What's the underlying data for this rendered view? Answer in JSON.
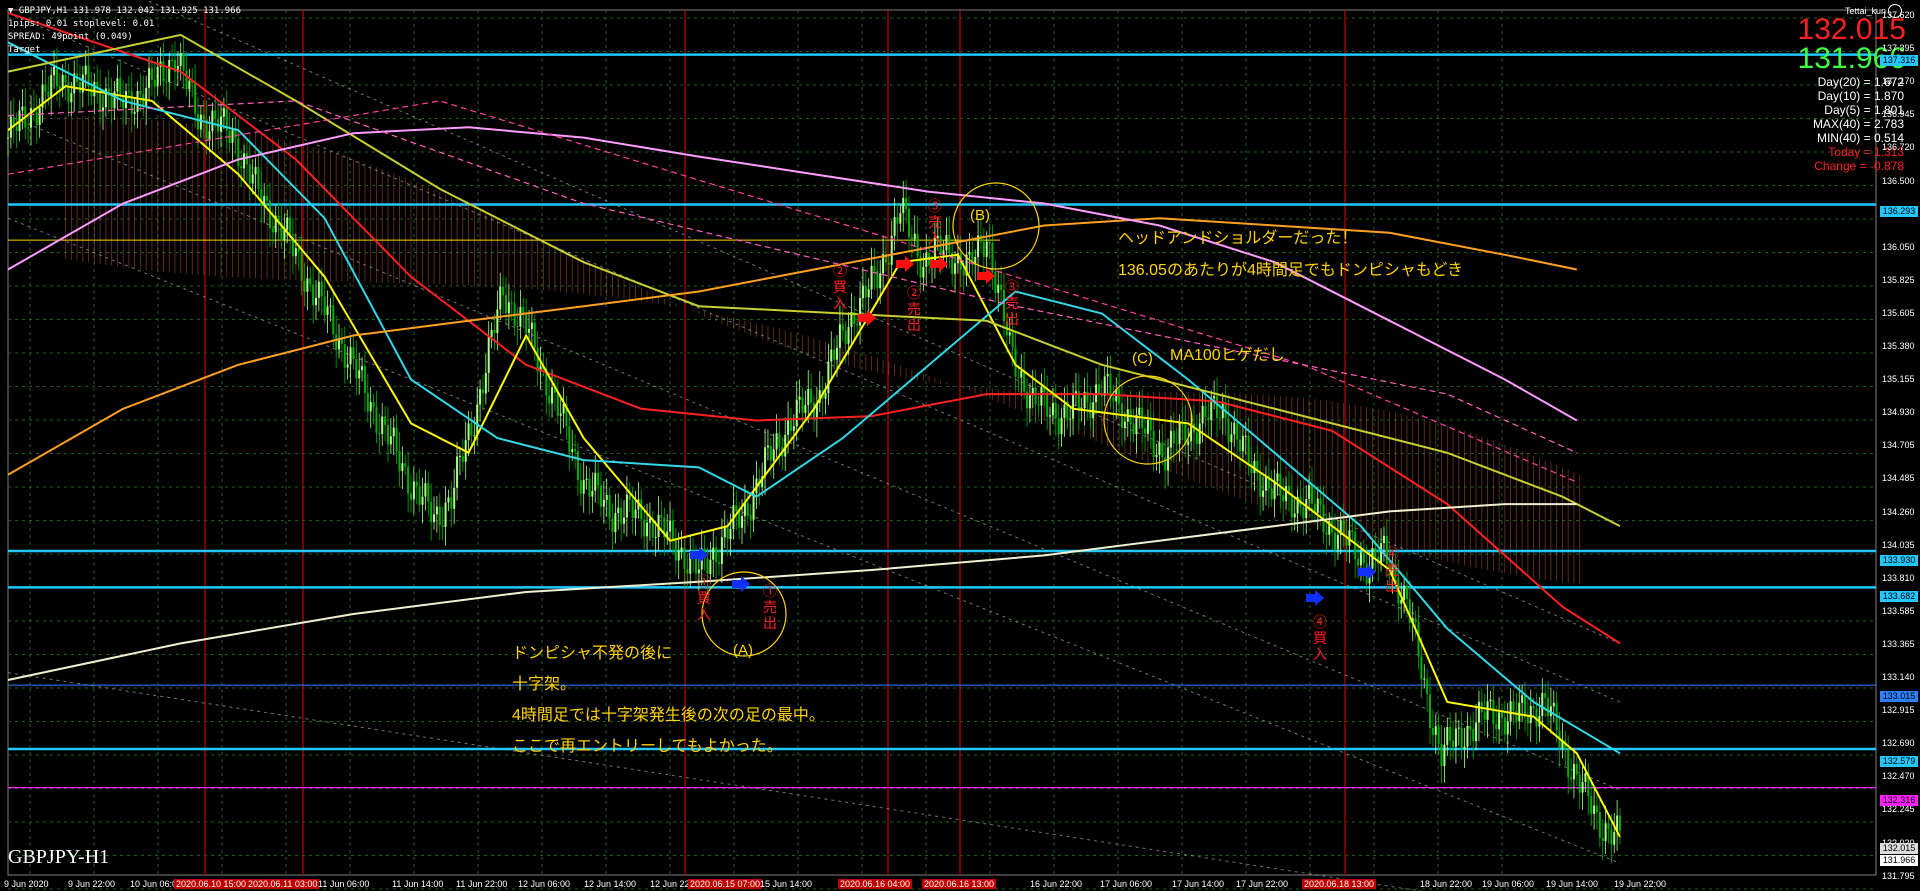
{
  "header": {
    "symbol_line": "▼ GBPJPY,H1  131.978 132.042 131.925 131.966",
    "pips_line": "1pips: 0.01  stoplevel: 0.01",
    "spread_line": "SPREAD: 49point (0.049)",
    "target_line": "Target",
    "brand": "Tettai_kun",
    "brand_icon": "face-icon"
  },
  "quote": {
    "ask": "132.015",
    "bid": "131.966",
    "ask_color": "#ff2020",
    "bid_color": "#40ff40"
  },
  "stats": [
    {
      "text": "Day(20) = 1.672",
      "color": "#ffffff"
    },
    {
      "text": "Day(10) = 1.870",
      "color": "#ffffff"
    },
    {
      "text": "Day(5) = 1.801",
      "color": "#ffffff"
    },
    {
      "text": "MAX(40) = 2.783",
      "color": "#ffffff"
    },
    {
      "text": "MIN(40) = 0.514",
      "color": "#ffffff"
    },
    {
      "text": "Today = 1.313",
      "color": "#ff2020"
    },
    {
      "text": "Change = -0.878",
      "color": "#ff2020"
    }
  ],
  "chart_title": "GBPJPY-H1",
  "price_axis": [
    "137.620",
    "137.395",
    "137.170",
    "136.945",
    "136.720",
    "136.500",
    "136.275",
    "136.050",
    "135.825",
    "135.605",
    "135.380",
    "135.155",
    "134.930",
    "134.705",
    "134.485",
    "134.260",
    "134.035",
    "133.810",
    "133.585",
    "133.365",
    "133.140",
    "132.915",
    "132.690",
    "132.470",
    "132.245",
    "132.020",
    "131.795"
  ],
  "price_boxes": [
    {
      "text": "137.316",
      "bg": "#22c8ff"
    },
    {
      "text": "136.293",
      "bg": "#22c8ff"
    },
    {
      "text": "133.930",
      "bg": "#22c8ff"
    },
    {
      "text": "133.682",
      "bg": "#22c8ff"
    },
    {
      "text": "133.015",
      "bg": "#2a80ff"
    },
    {
      "text": "132.579",
      "bg": "#22c8ff"
    },
    {
      "text": "132.316",
      "bg": "#ff20ff"
    },
    {
      "text": "132.015",
      "bg": "#dddddd"
    },
    {
      "text": "131.966",
      "bg": "#ffffff"
    }
  ],
  "time_axis": [
    {
      "text": "9 Jun 2020",
      "highlight": false
    },
    {
      "text": "9 Jun 22:00",
      "highlight": false
    },
    {
      "text": "10 Jun 06:00",
      "highlight": false
    },
    {
      "text": "2020.06.10 15:00",
      "highlight": true
    },
    {
      "text": "2020.06.11 03:00",
      "highlight": true
    },
    {
      "text": "11 Jun 06:00",
      "highlight": false
    },
    {
      "text": "11 Jun 14:00",
      "highlight": false
    },
    {
      "text": "11 Jun 22:00",
      "highlight": false
    },
    {
      "text": "12 Jun 06:00",
      "highlight": false
    },
    {
      "text": "12 Jun 14:00",
      "highlight": false
    },
    {
      "text": "12 Jun 22:00",
      "highlight": false
    },
    {
      "text": "2020.06.15 07:00",
      "highlight": true
    },
    {
      "text": "15 Jun 14:00",
      "highlight": false
    },
    {
      "text": "2020.06.16 04:00",
      "highlight": true
    },
    {
      "text": "2020.06.16 13:00",
      "highlight": true
    },
    {
      "text": "16 Jun 22:00",
      "highlight": false
    },
    {
      "text": "17 Jun 06:00",
      "highlight": false
    },
    {
      "text": "17 Jun 14:00",
      "highlight": false
    },
    {
      "text": "17 Jun 22:00",
      "highlight": false
    },
    {
      "text": "2020.06.18 13:00",
      "highlight": true
    },
    {
      "text": "18 Jun 22:00",
      "highlight": false
    },
    {
      "text": "19 Jun 06:00",
      "highlight": false
    },
    {
      "text": "19 Jun 14:00",
      "highlight": false
    },
    {
      "text": "19 Jun 22:00",
      "highlight": false
    }
  ],
  "annotations": {
    "head_shoulders": "ヘッドアンドショルダーだった！",
    "level_note": "136.05のあたりが4時間足でもドンピシャもどき",
    "ma100": "MA100ヒゲだし",
    "note_lines": [
      "ドンピシャ不発の後に",
      "十字架。",
      "4時間足では十字架発生後の次の足の最中。",
      "ここで再エントリーしてもよかった。"
    ],
    "circle_a": "(A)",
    "circle_b": "(B)",
    "circle_c": "(C)",
    "trades": {
      "t1_buy": "①買入",
      "t1_sell": "①売出",
      "t2_buy": "②買入",
      "t2_sell": "②売出",
      "t3_buy": "③売入",
      "t3_sell": "③売出",
      "t4_buy": "④買入",
      "t4_sell": "④売出"
    }
  },
  "arrow_icons": {
    "buy": "blue-arrow-right-icon",
    "sell": "red-arrow-right-icon"
  },
  "colors": {
    "bull": "#aaff88",
    "bear": "#00b000",
    "grid": "#1f5f1f",
    "hline": "#22c8ff",
    "vline": "#c00000",
    "ann": "#ffd400",
    "ma_red": "#ff2020",
    "ma_yellow": "#ffff00",
    "ma_cyan": "#30d8e8",
    "ma_olive": "#c8d030",
    "ma_orange": "#ffa020",
    "ma_pink": "#ff9cff",
    "ma_white": "#f0f0d0",
    "cloud": "#b05030"
  },
  "chart_data": {
    "type": "candlestick",
    "symbol": "GBPJPY",
    "timeframe": "H1",
    "ylim": [
      131.795,
      137.62
    ],
    "price_lines": [
      137.316,
      136.293,
      133.93,
      133.682,
      133.015,
      132.579,
      132.316
    ],
    "vertical_markers": [
      "2020.06.10 15:00",
      "2020.06.11 03:00",
      "2020.06.15 07:00",
      "2020.06.16 04:00",
      "2020.06.16 13:00",
      "2020.06.18 13:00"
    ],
    "close_path": [
      [
        0,
        136.75
      ],
      [
        18,
        137.15
      ],
      [
        30,
        137.08
      ],
      [
        40,
        136.99
      ],
      [
        50,
        137.1
      ],
      [
        58,
        137.32
      ],
      [
        66,
        136.9
      ],
      [
        78,
        136.78
      ],
      [
        86,
        136.4
      ],
      [
        96,
        136.1
      ],
      [
        104,
        135.78
      ],
      [
        112,
        135.5
      ],
      [
        122,
        135.1
      ],
      [
        132,
        134.7
      ],
      [
        140,
        134.4
      ],
      [
        148,
        134.15
      ],
      [
        154,
        134.3
      ],
      [
        162,
        134.85
      ],
      [
        172,
        135.7
      ],
      [
        180,
        135.45
      ],
      [
        190,
        134.95
      ],
      [
        200,
        134.4
      ],
      [
        210,
        134.2
      ],
      [
        220,
        134.18
      ],
      [
        232,
        133.98
      ],
      [
        240,
        133.78
      ],
      [
        248,
        134.0
      ],
      [
        256,
        134.2
      ],
      [
        264,
        134.55
      ],
      [
        272,
        134.82
      ],
      [
        282,
        135.0
      ],
      [
        292,
        135.5
      ],
      [
        302,
        135.8
      ],
      [
        310,
        136.25
      ],
      [
        318,
        135.9
      ],
      [
        326,
        136.0
      ],
      [
        334,
        135.85
      ],
      [
        340,
        136.1
      ],
      [
        348,
        135.3
      ],
      [
        356,
        134.95
      ],
      [
        368,
        134.85
      ],
      [
        380,
        135.05
      ],
      [
        392,
        134.8
      ],
      [
        402,
        134.6
      ],
      [
        414,
        134.82
      ],
      [
        422,
        134.9
      ],
      [
        432,
        134.5
      ],
      [
        442,
        134.3
      ],
      [
        452,
        134.25
      ],
      [
        462,
        134.05
      ],
      [
        472,
        133.85
      ],
      [
        478,
        133.9
      ],
      [
        486,
        133.6
      ],
      [
        492,
        133.0
      ],
      [
        498,
        132.55
      ],
      [
        506,
        132.7
      ],
      [
        514,
        132.82
      ],
      [
        524,
        132.8
      ],
      [
        534,
        132.9
      ],
      [
        540,
        132.6
      ],
      [
        546,
        132.35
      ],
      [
        552,
        132.1
      ],
      [
        560,
        131.97
      ]
    ],
    "candle_count": 561,
    "moving_averages": [
      {
        "color_key": "ma_red",
        "pts": [
          [
            0,
            137.6
          ],
          [
            60,
            137.2
          ],
          [
            100,
            136.6
          ],
          [
            140,
            135.8
          ],
          [
            180,
            135.2
          ],
          [
            220,
            134.9
          ],
          [
            260,
            134.82
          ],
          [
            300,
            134.85
          ],
          [
            340,
            135.0
          ],
          [
            380,
            135.0
          ],
          [
            420,
            134.95
          ],
          [
            460,
            134.75
          ],
          [
            500,
            134.25
          ],
          [
            540,
            133.55
          ],
          [
            560,
            133.3
          ]
        ]
      },
      {
        "color_key": "ma_yellow",
        "pts": [
          [
            0,
            136.8
          ],
          [
            20,
            137.1
          ],
          [
            50,
            137.0
          ],
          [
            80,
            136.5
          ],
          [
            110,
            135.8
          ],
          [
            140,
            134.8
          ],
          [
            160,
            134.6
          ],
          [
            180,
            135.4
          ],
          [
            200,
            134.7
          ],
          [
            230,
            134.0
          ],
          [
            250,
            134.1
          ],
          [
            280,
            134.9
          ],
          [
            310,
            135.9
          ],
          [
            330,
            135.95
          ],
          [
            350,
            135.2
          ],
          [
            370,
            134.9
          ],
          [
            410,
            134.8
          ],
          [
            440,
            134.4
          ],
          [
            480,
            133.8
          ],
          [
            500,
            132.9
          ],
          [
            530,
            132.8
          ],
          [
            545,
            132.55
          ],
          [
            560,
            131.98
          ]
        ]
      },
      {
        "color_key": "ma_cyan",
        "pts": [
          [
            0,
            137.4
          ],
          [
            40,
            137.0
          ],
          [
            80,
            136.8
          ],
          [
            110,
            136.2
          ],
          [
            140,
            135.1
          ],
          [
            170,
            134.7
          ],
          [
            200,
            134.55
          ],
          [
            240,
            134.5
          ],
          [
            260,
            134.3
          ],
          [
            290,
            134.7
          ],
          [
            320,
            135.2
          ],
          [
            350,
            135.7
          ],
          [
            380,
            135.55
          ],
          [
            410,
            135.1
          ],
          [
            440,
            134.6
          ],
          [
            470,
            134.1
          ],
          [
            500,
            133.4
          ],
          [
            530,
            132.9
          ],
          [
            560,
            132.55
          ]
        ]
      },
      {
        "color_key": "ma_olive",
        "pts": [
          [
            0,
            137.2
          ],
          [
            60,
            137.45
          ],
          [
            100,
            137.0
          ],
          [
            150,
            136.4
          ],
          [
            200,
            135.9
          ],
          [
            240,
            135.6
          ],
          [
            290,
            135.55
          ],
          [
            340,
            135.5
          ],
          [
            380,
            135.2
          ],
          [
            420,
            135.0
          ],
          [
            460,
            134.8
          ],
          [
            500,
            134.6
          ],
          [
            540,
            134.3
          ],
          [
            560,
            134.1
          ]
        ]
      },
      {
        "color_key": "ma_orange",
        "pts": [
          [
            0,
            134.45
          ],
          [
            40,
            134.9
          ],
          [
            80,
            135.2
          ],
          [
            120,
            135.4
          ],
          [
            160,
            135.5
          ],
          [
            200,
            135.6
          ],
          [
            240,
            135.7
          ],
          [
            280,
            135.85
          ],
          [
            320,
            136.0
          ],
          [
            360,
            136.15
          ],
          [
            400,
            136.2
          ],
          [
            440,
            136.15
          ],
          [
            480,
            136.1
          ],
          [
            520,
            135.95
          ],
          [
            545,
            135.85
          ]
        ]
      },
      {
        "color_key": "ma_pink",
        "pts": [
          [
            0,
            135.85
          ],
          [
            40,
            136.3
          ],
          [
            80,
            136.6
          ],
          [
            120,
            136.78
          ],
          [
            160,
            136.82
          ],
          [
            200,
            136.75
          ],
          [
            240,
            136.62
          ],
          [
            280,
            136.5
          ],
          [
            320,
            136.38
          ],
          [
            360,
            136.3
          ],
          [
            400,
            136.15
          ],
          [
            440,
            135.9
          ],
          [
            480,
            135.5
          ],
          [
            520,
            135.1
          ],
          [
            545,
            134.82
          ]
        ]
      },
      {
        "color_key": "ma_white",
        "pts": [
          [
            0,
            133.05
          ],
          [
            60,
            133.3
          ],
          [
            120,
            133.5
          ],
          [
            180,
            133.65
          ],
          [
            240,
            133.72
          ],
          [
            300,
            133.8
          ],
          [
            360,
            133.9
          ],
          [
            400,
            134.0
          ],
          [
            440,
            134.1
          ],
          [
            480,
            134.2
          ],
          [
            520,
            134.25
          ],
          [
            545,
            134.25
          ]
        ]
      }
    ],
    "trades": [
      {
        "label": "①買入",
        "x": 202,
        "price": 133.93,
        "side": "buy"
      },
      {
        "label": "①売出",
        "x": 215,
        "price": 133.72,
        "side": "buy"
      },
      {
        "label": "②買入",
        "x": 250,
        "price": 135.55,
        "side": "sell"
      },
      {
        "label": "②売出",
        "x": 262,
        "price": 135.95,
        "side": "sell"
      },
      {
        "label": "③売入",
        "x": 272,
        "price": 135.95,
        "side": "sell"
      },
      {
        "label": "③売出",
        "x": 286,
        "price": 135.85,
        "side": "sell"
      },
      {
        "label": "④買入",
        "x": 384,
        "price": 133.62,
        "side": "buy"
      },
      {
        "label": "④売出",
        "x": 398,
        "price": 133.85,
        "side": "buy"
      }
    ]
  }
}
